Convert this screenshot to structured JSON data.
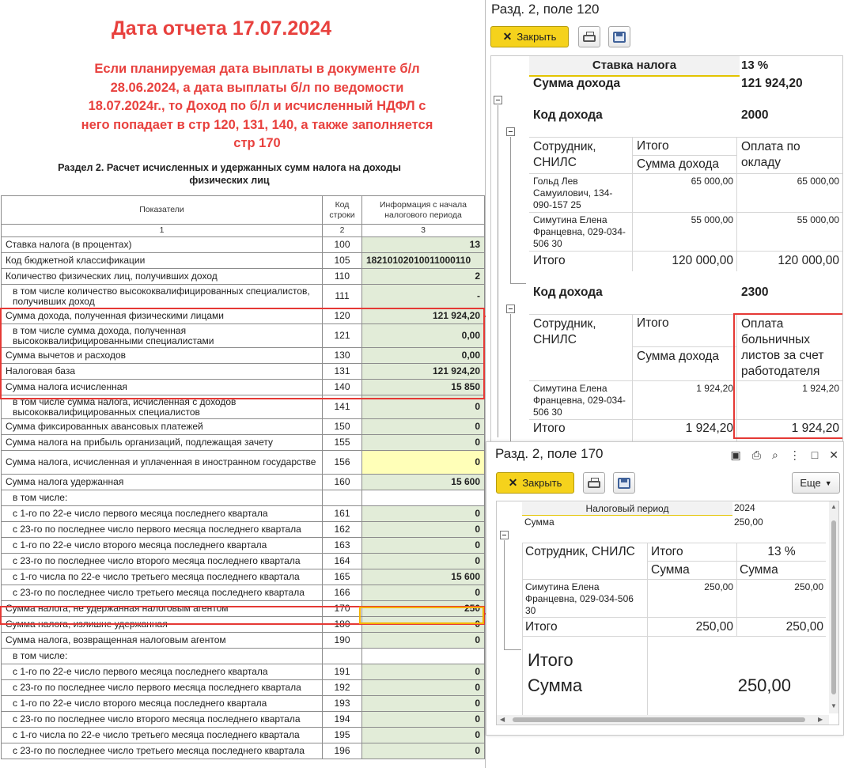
{
  "report": {
    "date_title": "Дата отчета 17.07.2024",
    "note": "Если планируемая дата выплаты в документе б/л 28.06.2024, а дата выплаты б/л по ведомости 18.07.2024г., то  Доход по б/л и исчисленный НДФЛ с него попадает в стр 120, 131, 140, а также заполняется стр 170",
    "section_title": "Раздел 2. Расчет исчисленных и удержанных сумм налога на доходы физических лиц",
    "headers": {
      "indicator": "Показатели",
      "code": "Код строки",
      "info": "Информация с начала налогового периода",
      "n1": "1",
      "n2": "2",
      "n3": "3"
    },
    "rows": [
      {
        "label": "Ставка налога (в процентах)",
        "code": "100",
        "value": "13"
      },
      {
        "label": "Код бюджетной классификации",
        "code": "105",
        "value": "18210102010011000110"
      },
      {
        "label": "Количество физических лиц, получивших доход",
        "code": "110",
        "value": "2"
      },
      {
        "label": "в том числе количество высококвалифицированных специалистов, получивших доход",
        "code": "111",
        "value": "-"
      },
      {
        "label": "Сумма дохода, полученная физическими лицами",
        "code": "120",
        "value": "121 924,20"
      },
      {
        "label": "в том числе сумма дохода, полученная высококвалифицированными специалистами",
        "code": "121",
        "value": "0,00"
      },
      {
        "label": "Сумма вычетов и расходов",
        "code": "130",
        "value": "0,00"
      },
      {
        "label": "Налоговая база",
        "code": "131",
        "value": "121 924,20"
      },
      {
        "label": "Сумма налога исчисленная",
        "code": "140",
        "value": "15 850"
      },
      {
        "label": "в том числе сумма налога, исчисленная с доходов высококвалифицированных специалистов",
        "code": "141",
        "value": "0"
      },
      {
        "label": "Сумма фиксированных авансовых платежей",
        "code": "150",
        "value": "0"
      },
      {
        "label": "Сумма налога на прибыль организаций, подлежащая зачету",
        "code": "155",
        "value": "0"
      },
      {
        "label": "Сумма налога, исчисленная и уплаченная в иностранном государстве",
        "code": "156",
        "value": "0"
      },
      {
        "label": "Сумма налога удержанная",
        "code": "160",
        "value": "15 600"
      },
      {
        "label": "в том числе:",
        "code": "",
        "value": ""
      },
      {
        "label": "с 1-го по 22-е число первого месяца последнего квартала",
        "code": "161",
        "value": "0"
      },
      {
        "label": "с 23-го по последнее число первого месяца последнего квартала",
        "code": "162",
        "value": "0"
      },
      {
        "label": "с 1-го по 22-е число второго месяца последнего квартала",
        "code": "163",
        "value": "0"
      },
      {
        "label": "с 23-го по последнее число второго месяца последнего квартала",
        "code": "164",
        "value": "0"
      },
      {
        "label": "с 1-го числа по 22-е число третьего месяца последнего квартала",
        "code": "165",
        "value": "15 600"
      },
      {
        "label": "с 23-го по последнее число третьего месяца последнего квартала",
        "code": "166",
        "value": "0"
      },
      {
        "label": "Сумма налога, не удержанная налоговым агентом",
        "code": "170",
        "value": "250"
      },
      {
        "label": "Сумма налога, излишне удержанная",
        "code": "180",
        "value": "0"
      },
      {
        "label": "Сумма налога, возвращенная налоговым агентом",
        "code": "190",
        "value": "0"
      },
      {
        "label": "в том числе:",
        "code": "",
        "value": ""
      },
      {
        "label": "с 1-го по 22-е число первого месяца последнего квартала",
        "code": "191",
        "value": "0"
      },
      {
        "label": "с 23-го по последнее число первого месяца последнего квартала",
        "code": "192",
        "value": "0"
      },
      {
        "label": "с 1-го по 22-е число второго месяца последнего квартала",
        "code": "193",
        "value": "0"
      },
      {
        "label": "с 23-го по последнее число второго месяца последнего квартала",
        "code": "194",
        "value": "0"
      },
      {
        "label": "с 1-го числа по 22-е число третьего месяца последнего квартала",
        "code": "195",
        "value": "0"
      },
      {
        "label": "с 23-го по последнее число третьего месяца последнего квартала",
        "code": "196",
        "value": "0"
      }
    ]
  },
  "win120": {
    "title": "Разд. 2, поле 120",
    "close_label": "Закрыть",
    "rate_label": "Ставка налога",
    "rate_value": "13 %",
    "income_label": "Сумма дохода",
    "income_value": "121 924,20",
    "code_label": "Код дохода",
    "group1": {
      "code": "2000",
      "col_employee": "Сотрудник, СНИЛС",
      "col_total": "Итого",
      "col_total_sub": "Сумма дохода",
      "col_pay": "Оплата по окладу",
      "rows": [
        {
          "name": "Гольд Лев Самуилович, 134-090-157 25",
          "total": "65 000,00",
          "pay": "65 000,00"
        },
        {
          "name": "Симутина Елена Францевна, 029-034-506 30",
          "total": "55 000,00",
          "pay": "55 000,00"
        }
      ],
      "sum_label": "Итого",
      "sum_total": "120 000,00",
      "sum_pay": "120 000,00"
    },
    "group2": {
      "code": "2300",
      "col_employee": "Сотрудник, СНИЛС",
      "col_total": "Итого",
      "col_total_sub": "Сумма дохода",
      "col_pay": "Оплата больничных листов за счет работодателя",
      "rows": [
        {
          "name": "Симутина Елена Францевна, 029-034-506 30",
          "total": "1 924,20",
          "pay": "1 924,20"
        }
      ],
      "sum_label": "Итого",
      "sum_total": "1 924,20",
      "sum_pay": "1 924,20"
    }
  },
  "win170": {
    "title": "Разд. 2, поле 170",
    "close_label": "Закрыть",
    "more_label": "Еще",
    "period_label": "Налоговый период",
    "period_value": "2024",
    "sum_label": "Сумма",
    "sum_value": "250,00",
    "col_employee": "Сотрудник, СНИЛС",
    "col_total": "Итого",
    "col_rate": "13 %",
    "col_sub1": "Сумма",
    "col_sub2": "Сумма",
    "row_name": "Симутина Елена Францевна, 029-034-506 30",
    "row_total": "250,00",
    "row_rate": "250,00",
    "itogo_label": "Итого",
    "itogo_total": "250,00",
    "itogo_rate": "250,00",
    "grand_label1": "Итого",
    "grand_label2": "Сумма",
    "grand_value": "250,00"
  }
}
